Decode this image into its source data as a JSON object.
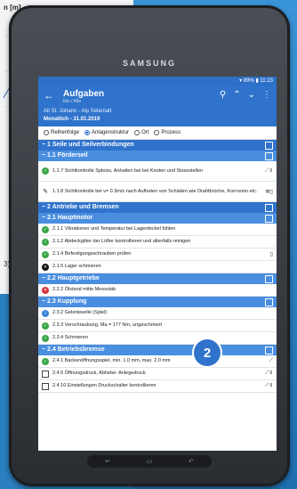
{
  "background": {
    "chart_title": "n [m]",
    "side_label": "3)"
  },
  "device": {
    "brand": "SAMSUNG"
  },
  "status": {
    "text": "▾ 89% ▮ 11:23"
  },
  "appbar": {
    "back_icon": "arrow-left-icon",
    "title": "Aufgaben",
    "subtitle": "Ibis / Alle",
    "location": "Alt St. Johann - Alp Selamatt",
    "date": "Monatlich - 31.01.2019",
    "icons": [
      "search-icon",
      "chevron-up-icon",
      "chevron-down-icon",
      "more-icon"
    ]
  },
  "radios": [
    {
      "label": "Reihenfolge",
      "selected": false
    },
    {
      "label": "Anlagenstruktur",
      "selected": true
    },
    {
      "label": "Ort",
      "selected": false
    },
    {
      "label": "Prozess",
      "selected": false
    }
  ],
  "sections": {
    "s1": "1 Seile und Seilverbindungen",
    "s11": "1.1 Förderseil",
    "s2": "2 Antriebe und Bremsen",
    "s21": "2.1 Hauptmotor",
    "s22": "2.2 Hauptgetriebe",
    "s23": "2.3 Kupplung",
    "s24": "2.4 Betriebsbremse"
  },
  "rows": {
    "r117": "1.1.7 Sichtkontrolle Spleiss, Anhalten bei bei Knoten und Stossstellen",
    "r118": "1.1.8 Sichtkontrolle bei v= 0.3m/s nach Auftreten von Schäden wie Drahtbrüche, Korrosion etc.",
    "r211": "2.1.1 Vibrationen und Temperatur bei Lagerdeckel fühlen",
    "r212": "2.1.2 Abdeckgitter der Lüfter kontrollieren und allenfalls reinigen",
    "r214": "2.1.4 Befestigungsschrauben prüfen",
    "r215": "2.1.5 Lager schmieren",
    "r222": "2.2.2 Ölstand mitte Messstab",
    "r232": "2.3.2 Gelenkwelle (Spiel)",
    "r233": "2.3.3 Verschraubung, Ma = 177 Nm, ungeschmiert",
    "r234": "2.3.4 Schmieren",
    "r241": "2.4.1 Backenöffnungsspiel, min. 1.0 mm, max. 2.0 mm",
    "r245": "2.4.5 Öffnungsdruck, Abhebe- Anlegedruck",
    "r2410": "2.4.10 Einstellungen Druckschalter kontrollieren"
  },
  "badge": "2",
  "navbar": [
    "back-icon",
    "home-icon",
    "recents-icon"
  ]
}
